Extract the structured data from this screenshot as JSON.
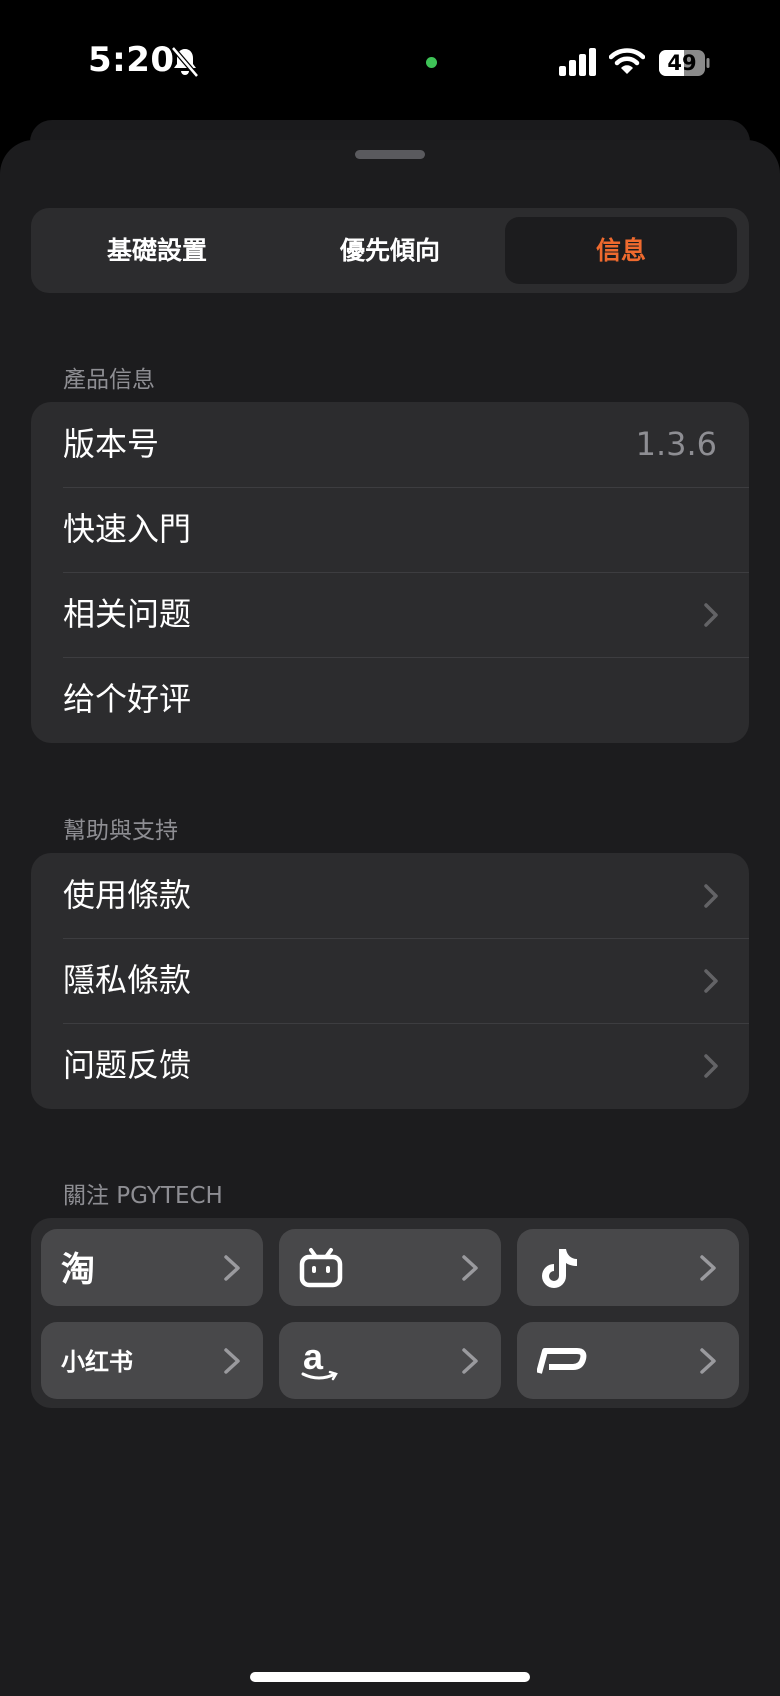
{
  "status": {
    "time": "5:20",
    "battery": "49",
    "icons": [
      "silent-bell-icon",
      "camera-indicator-icon",
      "signal-icon",
      "wifi-icon",
      "battery-icon"
    ]
  },
  "tabs": [
    {
      "label": "基礎設置",
      "active": false
    },
    {
      "label": "優先傾向",
      "active": false
    },
    {
      "label": "信息",
      "active": true
    }
  ],
  "accent_color": "#ef6a2e",
  "product_info": {
    "header": "產品信息",
    "rows": [
      {
        "label": "版本号",
        "value": "1.3.6"
      },
      {
        "label": "快速入門"
      },
      {
        "label": "相关问题"
      },
      {
        "label": "给个好评"
      }
    ]
  },
  "help_support": {
    "header": "幫助與支持",
    "rows": [
      {
        "label": "使用條款"
      },
      {
        "label": "隱私條款"
      },
      {
        "label": "问题反馈"
      }
    ]
  },
  "follow": {
    "header": "關注 PGYTECH",
    "tiles": [
      {
        "icon": "taobao-icon",
        "text": "淘"
      },
      {
        "icon": "bilibili-icon"
      },
      {
        "icon": "tiktok-icon"
      },
      {
        "icon": "xiaohongshu-icon",
        "text": "小红书"
      },
      {
        "icon": "amazon-icon",
        "text": "a"
      },
      {
        "icon": "pgytech-icon"
      }
    ]
  }
}
